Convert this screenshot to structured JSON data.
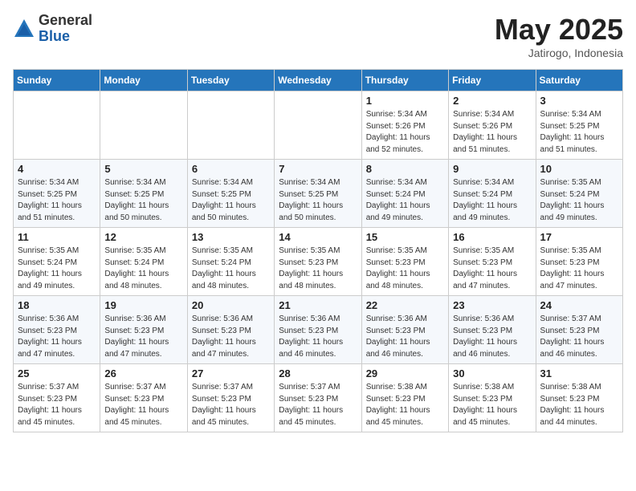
{
  "header": {
    "logo_general": "General",
    "logo_blue": "Blue",
    "month_year": "May 2025",
    "location": "Jatirogo, Indonesia"
  },
  "weekdays": [
    "Sunday",
    "Monday",
    "Tuesday",
    "Wednesday",
    "Thursday",
    "Friday",
    "Saturday"
  ],
  "weeks": [
    [
      {
        "day": "",
        "info": ""
      },
      {
        "day": "",
        "info": ""
      },
      {
        "day": "",
        "info": ""
      },
      {
        "day": "",
        "info": ""
      },
      {
        "day": "1",
        "info": "Sunrise: 5:34 AM\nSunset: 5:26 PM\nDaylight: 11 hours\nand 52 minutes."
      },
      {
        "day": "2",
        "info": "Sunrise: 5:34 AM\nSunset: 5:26 PM\nDaylight: 11 hours\nand 51 minutes."
      },
      {
        "day": "3",
        "info": "Sunrise: 5:34 AM\nSunset: 5:25 PM\nDaylight: 11 hours\nand 51 minutes."
      }
    ],
    [
      {
        "day": "4",
        "info": "Sunrise: 5:34 AM\nSunset: 5:25 PM\nDaylight: 11 hours\nand 51 minutes."
      },
      {
        "day": "5",
        "info": "Sunrise: 5:34 AM\nSunset: 5:25 PM\nDaylight: 11 hours\nand 50 minutes."
      },
      {
        "day": "6",
        "info": "Sunrise: 5:34 AM\nSunset: 5:25 PM\nDaylight: 11 hours\nand 50 minutes."
      },
      {
        "day": "7",
        "info": "Sunrise: 5:34 AM\nSunset: 5:25 PM\nDaylight: 11 hours\nand 50 minutes."
      },
      {
        "day": "8",
        "info": "Sunrise: 5:34 AM\nSunset: 5:24 PM\nDaylight: 11 hours\nand 49 minutes."
      },
      {
        "day": "9",
        "info": "Sunrise: 5:34 AM\nSunset: 5:24 PM\nDaylight: 11 hours\nand 49 minutes."
      },
      {
        "day": "10",
        "info": "Sunrise: 5:35 AM\nSunset: 5:24 PM\nDaylight: 11 hours\nand 49 minutes."
      }
    ],
    [
      {
        "day": "11",
        "info": "Sunrise: 5:35 AM\nSunset: 5:24 PM\nDaylight: 11 hours\nand 49 minutes."
      },
      {
        "day": "12",
        "info": "Sunrise: 5:35 AM\nSunset: 5:24 PM\nDaylight: 11 hours\nand 48 minutes."
      },
      {
        "day": "13",
        "info": "Sunrise: 5:35 AM\nSunset: 5:24 PM\nDaylight: 11 hours\nand 48 minutes."
      },
      {
        "day": "14",
        "info": "Sunrise: 5:35 AM\nSunset: 5:23 PM\nDaylight: 11 hours\nand 48 minutes."
      },
      {
        "day": "15",
        "info": "Sunrise: 5:35 AM\nSunset: 5:23 PM\nDaylight: 11 hours\nand 48 minutes."
      },
      {
        "day": "16",
        "info": "Sunrise: 5:35 AM\nSunset: 5:23 PM\nDaylight: 11 hours\nand 47 minutes."
      },
      {
        "day": "17",
        "info": "Sunrise: 5:35 AM\nSunset: 5:23 PM\nDaylight: 11 hours\nand 47 minutes."
      }
    ],
    [
      {
        "day": "18",
        "info": "Sunrise: 5:36 AM\nSunset: 5:23 PM\nDaylight: 11 hours\nand 47 minutes."
      },
      {
        "day": "19",
        "info": "Sunrise: 5:36 AM\nSunset: 5:23 PM\nDaylight: 11 hours\nand 47 minutes."
      },
      {
        "day": "20",
        "info": "Sunrise: 5:36 AM\nSunset: 5:23 PM\nDaylight: 11 hours\nand 47 minutes."
      },
      {
        "day": "21",
        "info": "Sunrise: 5:36 AM\nSunset: 5:23 PM\nDaylight: 11 hours\nand 46 minutes."
      },
      {
        "day": "22",
        "info": "Sunrise: 5:36 AM\nSunset: 5:23 PM\nDaylight: 11 hours\nand 46 minutes."
      },
      {
        "day": "23",
        "info": "Sunrise: 5:36 AM\nSunset: 5:23 PM\nDaylight: 11 hours\nand 46 minutes."
      },
      {
        "day": "24",
        "info": "Sunrise: 5:37 AM\nSunset: 5:23 PM\nDaylight: 11 hours\nand 46 minutes."
      }
    ],
    [
      {
        "day": "25",
        "info": "Sunrise: 5:37 AM\nSunset: 5:23 PM\nDaylight: 11 hours\nand 45 minutes."
      },
      {
        "day": "26",
        "info": "Sunrise: 5:37 AM\nSunset: 5:23 PM\nDaylight: 11 hours\nand 45 minutes."
      },
      {
        "day": "27",
        "info": "Sunrise: 5:37 AM\nSunset: 5:23 PM\nDaylight: 11 hours\nand 45 minutes."
      },
      {
        "day": "28",
        "info": "Sunrise: 5:37 AM\nSunset: 5:23 PM\nDaylight: 11 hours\nand 45 minutes."
      },
      {
        "day": "29",
        "info": "Sunrise: 5:38 AM\nSunset: 5:23 PM\nDaylight: 11 hours\nand 45 minutes."
      },
      {
        "day": "30",
        "info": "Sunrise: 5:38 AM\nSunset: 5:23 PM\nDaylight: 11 hours\nand 45 minutes."
      },
      {
        "day": "31",
        "info": "Sunrise: 5:38 AM\nSunset: 5:23 PM\nDaylight: 11 hours\nand 44 minutes."
      }
    ]
  ]
}
